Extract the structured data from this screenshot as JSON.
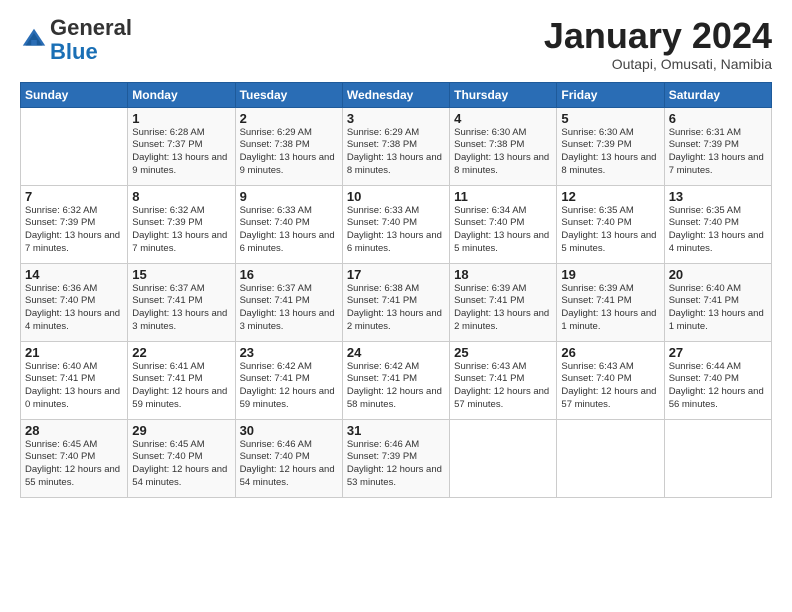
{
  "logo": {
    "general": "General",
    "blue": "Blue"
  },
  "title": "January 2024",
  "location": "Outapi, Omusati, Namibia",
  "days_of_week": [
    "Sunday",
    "Monday",
    "Tuesday",
    "Wednesday",
    "Thursday",
    "Friday",
    "Saturday"
  ],
  "weeks": [
    [
      {
        "day": "",
        "sunrise": "",
        "sunset": "",
        "daylight": ""
      },
      {
        "day": "1",
        "sunrise": "6:28 AM",
        "sunset": "7:37 PM",
        "daylight": "13 hours and 9 minutes."
      },
      {
        "day": "2",
        "sunrise": "6:29 AM",
        "sunset": "7:38 PM",
        "daylight": "13 hours and 9 minutes."
      },
      {
        "day": "3",
        "sunrise": "6:29 AM",
        "sunset": "7:38 PM",
        "daylight": "13 hours and 8 minutes."
      },
      {
        "day": "4",
        "sunrise": "6:30 AM",
        "sunset": "7:38 PM",
        "daylight": "13 hours and 8 minutes."
      },
      {
        "day": "5",
        "sunrise": "6:30 AM",
        "sunset": "7:39 PM",
        "daylight": "13 hours and 8 minutes."
      },
      {
        "day": "6",
        "sunrise": "6:31 AM",
        "sunset": "7:39 PM",
        "daylight": "13 hours and 7 minutes."
      }
    ],
    [
      {
        "day": "7",
        "sunrise": "6:32 AM",
        "sunset": "7:39 PM",
        "daylight": "13 hours and 7 minutes."
      },
      {
        "day": "8",
        "sunrise": "6:32 AM",
        "sunset": "7:39 PM",
        "daylight": "13 hours and 7 minutes."
      },
      {
        "day": "9",
        "sunrise": "6:33 AM",
        "sunset": "7:40 PM",
        "daylight": "13 hours and 6 minutes."
      },
      {
        "day": "10",
        "sunrise": "6:33 AM",
        "sunset": "7:40 PM",
        "daylight": "13 hours and 6 minutes."
      },
      {
        "day": "11",
        "sunrise": "6:34 AM",
        "sunset": "7:40 PM",
        "daylight": "13 hours and 5 minutes."
      },
      {
        "day": "12",
        "sunrise": "6:35 AM",
        "sunset": "7:40 PM",
        "daylight": "13 hours and 5 minutes."
      },
      {
        "day": "13",
        "sunrise": "6:35 AM",
        "sunset": "7:40 PM",
        "daylight": "13 hours and 4 minutes."
      }
    ],
    [
      {
        "day": "14",
        "sunrise": "6:36 AM",
        "sunset": "7:40 PM",
        "daylight": "13 hours and 4 minutes."
      },
      {
        "day": "15",
        "sunrise": "6:37 AM",
        "sunset": "7:41 PM",
        "daylight": "13 hours and 3 minutes."
      },
      {
        "day": "16",
        "sunrise": "6:37 AM",
        "sunset": "7:41 PM",
        "daylight": "13 hours and 3 minutes."
      },
      {
        "day": "17",
        "sunrise": "6:38 AM",
        "sunset": "7:41 PM",
        "daylight": "13 hours and 2 minutes."
      },
      {
        "day": "18",
        "sunrise": "6:39 AM",
        "sunset": "7:41 PM",
        "daylight": "13 hours and 2 minutes."
      },
      {
        "day": "19",
        "sunrise": "6:39 AM",
        "sunset": "7:41 PM",
        "daylight": "13 hours and 1 minute."
      },
      {
        "day": "20",
        "sunrise": "6:40 AM",
        "sunset": "7:41 PM",
        "daylight": "13 hours and 1 minute."
      }
    ],
    [
      {
        "day": "21",
        "sunrise": "6:40 AM",
        "sunset": "7:41 PM",
        "daylight": "13 hours and 0 minutes."
      },
      {
        "day": "22",
        "sunrise": "6:41 AM",
        "sunset": "7:41 PM",
        "daylight": "12 hours and 59 minutes."
      },
      {
        "day": "23",
        "sunrise": "6:42 AM",
        "sunset": "7:41 PM",
        "daylight": "12 hours and 59 minutes."
      },
      {
        "day": "24",
        "sunrise": "6:42 AM",
        "sunset": "7:41 PM",
        "daylight": "12 hours and 58 minutes."
      },
      {
        "day": "25",
        "sunrise": "6:43 AM",
        "sunset": "7:41 PM",
        "daylight": "12 hours and 57 minutes."
      },
      {
        "day": "26",
        "sunrise": "6:43 AM",
        "sunset": "7:40 PM",
        "daylight": "12 hours and 57 minutes."
      },
      {
        "day": "27",
        "sunrise": "6:44 AM",
        "sunset": "7:40 PM",
        "daylight": "12 hours and 56 minutes."
      }
    ],
    [
      {
        "day": "28",
        "sunrise": "6:45 AM",
        "sunset": "7:40 PM",
        "daylight": "12 hours and 55 minutes."
      },
      {
        "day": "29",
        "sunrise": "6:45 AM",
        "sunset": "7:40 PM",
        "daylight": "12 hours and 54 minutes."
      },
      {
        "day": "30",
        "sunrise": "6:46 AM",
        "sunset": "7:40 PM",
        "daylight": "12 hours and 54 minutes."
      },
      {
        "day": "31",
        "sunrise": "6:46 AM",
        "sunset": "7:39 PM",
        "daylight": "12 hours and 53 minutes."
      },
      {
        "day": "",
        "sunrise": "",
        "sunset": "",
        "daylight": ""
      },
      {
        "day": "",
        "sunrise": "",
        "sunset": "",
        "daylight": ""
      },
      {
        "day": "",
        "sunrise": "",
        "sunset": "",
        "daylight": ""
      }
    ]
  ]
}
